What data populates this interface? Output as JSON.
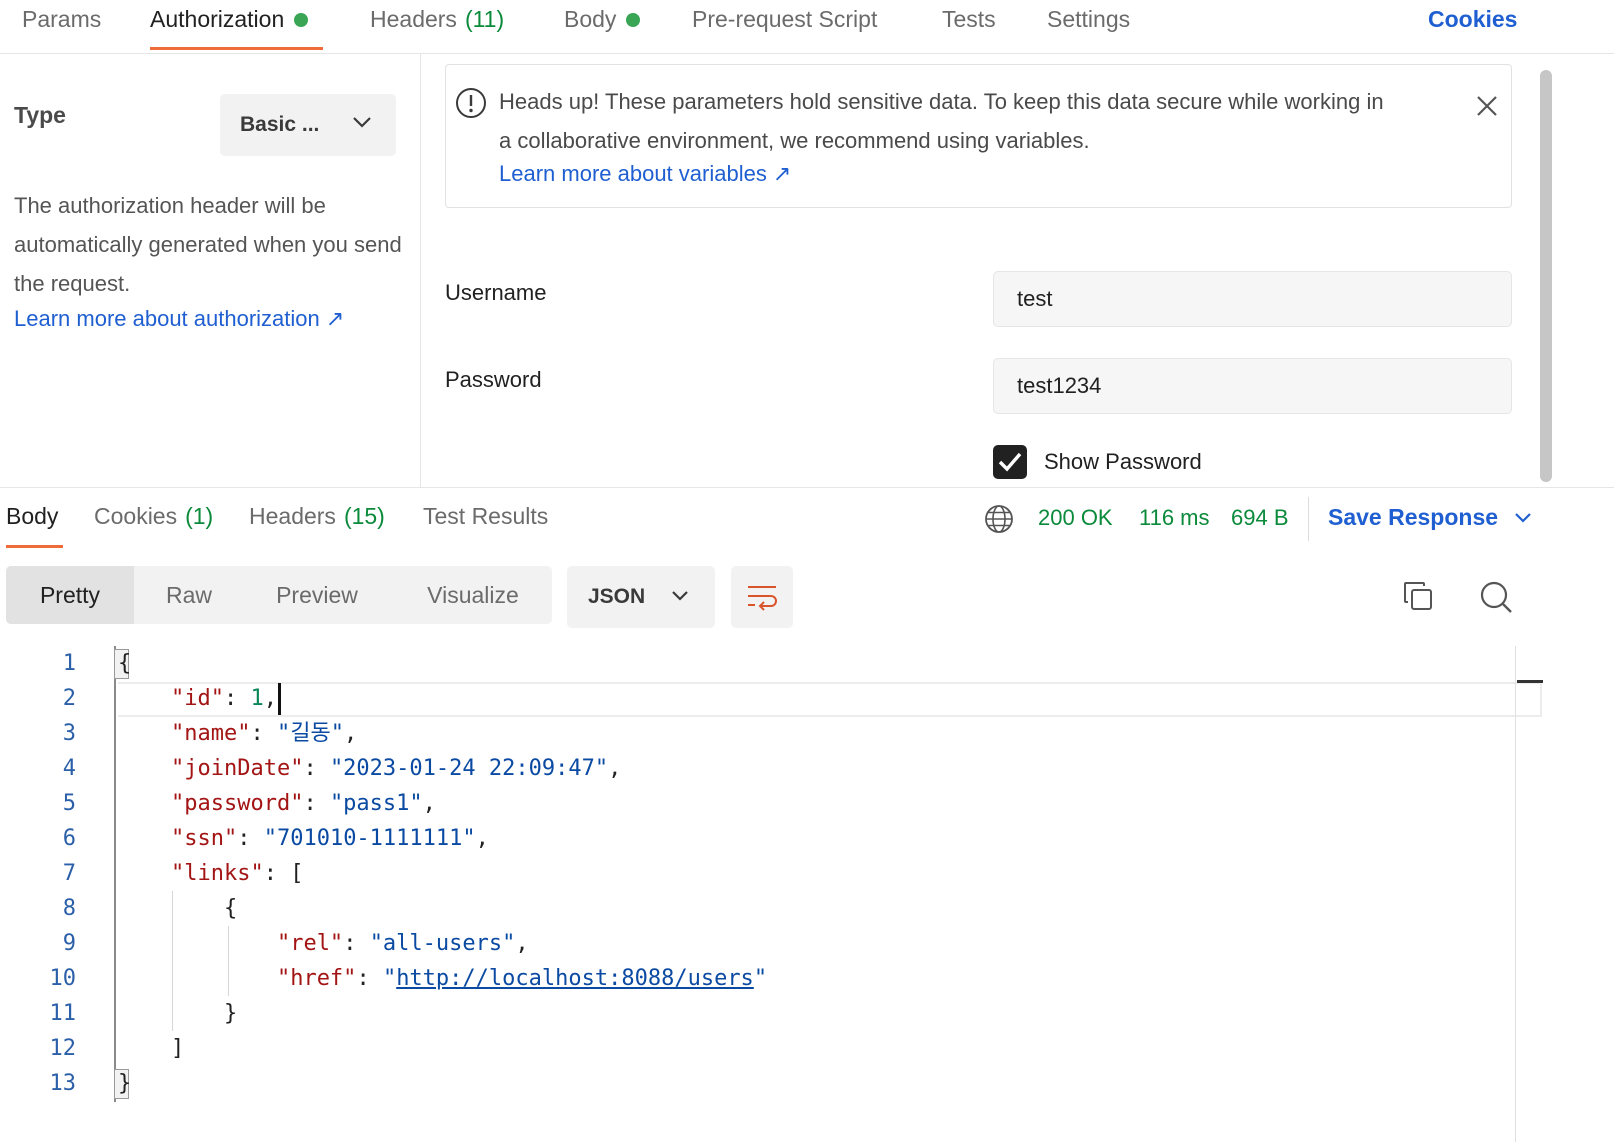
{
  "request_tabs": {
    "params": "Params",
    "authorization": "Authorization",
    "headers": "Headers",
    "headers_count": "(11)",
    "body": "Body",
    "prerequest": "Pre-request Script",
    "tests": "Tests",
    "settings": "Settings",
    "cookies": "Cookies"
  },
  "auth": {
    "type_label": "Type",
    "type_value": "Basic ...",
    "description": "The authorization header will be automatically generated when you send the request.",
    "learn_more": "Learn more about authorization ↗",
    "alert_text": "Heads up! These parameters hold sensitive data. To keep this data secure while working in a collaborative environment, we recommend using variables.",
    "alert_link": "Learn more about variables ↗",
    "username_label": "Username",
    "username_value": "test",
    "password_label": "Password",
    "password_value": "test1234",
    "show_password": "Show Password"
  },
  "response_tabs": {
    "body": "Body",
    "cookies": "Cookies",
    "cookies_count": "(1)",
    "headers": "Headers",
    "headers_count": "(15)",
    "test_results": "Test Results"
  },
  "status": {
    "code": "200 OK",
    "time": "116 ms",
    "size": "694 B",
    "save_response": "Save Response"
  },
  "view": {
    "pretty": "Pretty",
    "raw": "Raw",
    "preview": "Preview",
    "visualize": "Visualize",
    "format": "JSON"
  },
  "code": {
    "line_numbers": [
      "1",
      "2",
      "3",
      "4",
      "5",
      "6",
      "7",
      "8",
      "9",
      "10",
      "11",
      "12",
      "13"
    ],
    "id_value": "1",
    "name_value": "\"길동\"",
    "joinDate_value": "\"2023-01-24 22:09:47\"",
    "password_value": "\"pass1\"",
    "ssn_value": "\"701010-1111111\"",
    "rel_value": "\"all-users\"",
    "href_value": "http://localhost:8088/users"
  },
  "colors": {
    "accent_orange": "#ef6c3a",
    "link_blue": "#1f5fd1",
    "status_green": "#0a8a3a",
    "json_key": "#a31515",
    "json_string": "#0b4aa2"
  },
  "icons": [
    "alert-circle-icon",
    "close-icon",
    "chevron-down-icon",
    "check-icon",
    "globe-icon",
    "wrap-lines-icon",
    "copy-icon",
    "search-icon"
  ]
}
